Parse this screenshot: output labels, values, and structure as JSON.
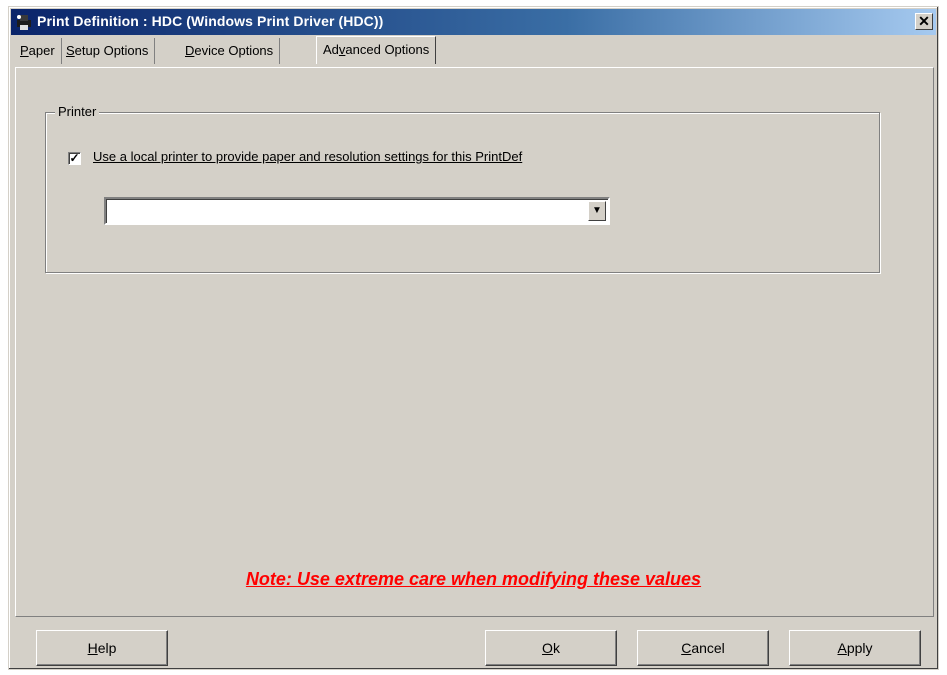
{
  "window": {
    "title": "Print Definition : HDC (Windows Print Driver (HDC))",
    "close_glyph": "✕"
  },
  "tabs": [
    {
      "mnemonic": "P",
      "rest": "aper",
      "active": false
    },
    {
      "mnemonic": "S",
      "rest": "etup Options",
      "active": false
    },
    {
      "mnemonic": "D",
      "rest": "evice Options",
      "active": false
    },
    {
      "pre": "Ad",
      "mnemonic": "v",
      "rest": "anced Options",
      "active": true
    }
  ],
  "printer_group": {
    "label": "Printer",
    "checkbox_checked": true,
    "checkbox_mark": "✓",
    "checkbox_label": "Use a local printer to provide paper and resolution settings for this PrintDef",
    "printer_select_value": "",
    "select_arrow": "▼"
  },
  "note": "Note: Use extreme care when modifying these values",
  "buttons": {
    "help": {
      "mnemonic": "H",
      "rest": "elp"
    },
    "ok": {
      "mnemonic": "O",
      "rest": "k"
    },
    "cancel": {
      "mnemonic": "C",
      "rest": "ancel"
    },
    "apply": {
      "mnemonic": "A",
      "rest": "pply"
    }
  },
  "colors": {
    "title_bar": "#0a246a",
    "dialog_bg": "#d4d0c8",
    "note_text": "#ff0000"
  }
}
